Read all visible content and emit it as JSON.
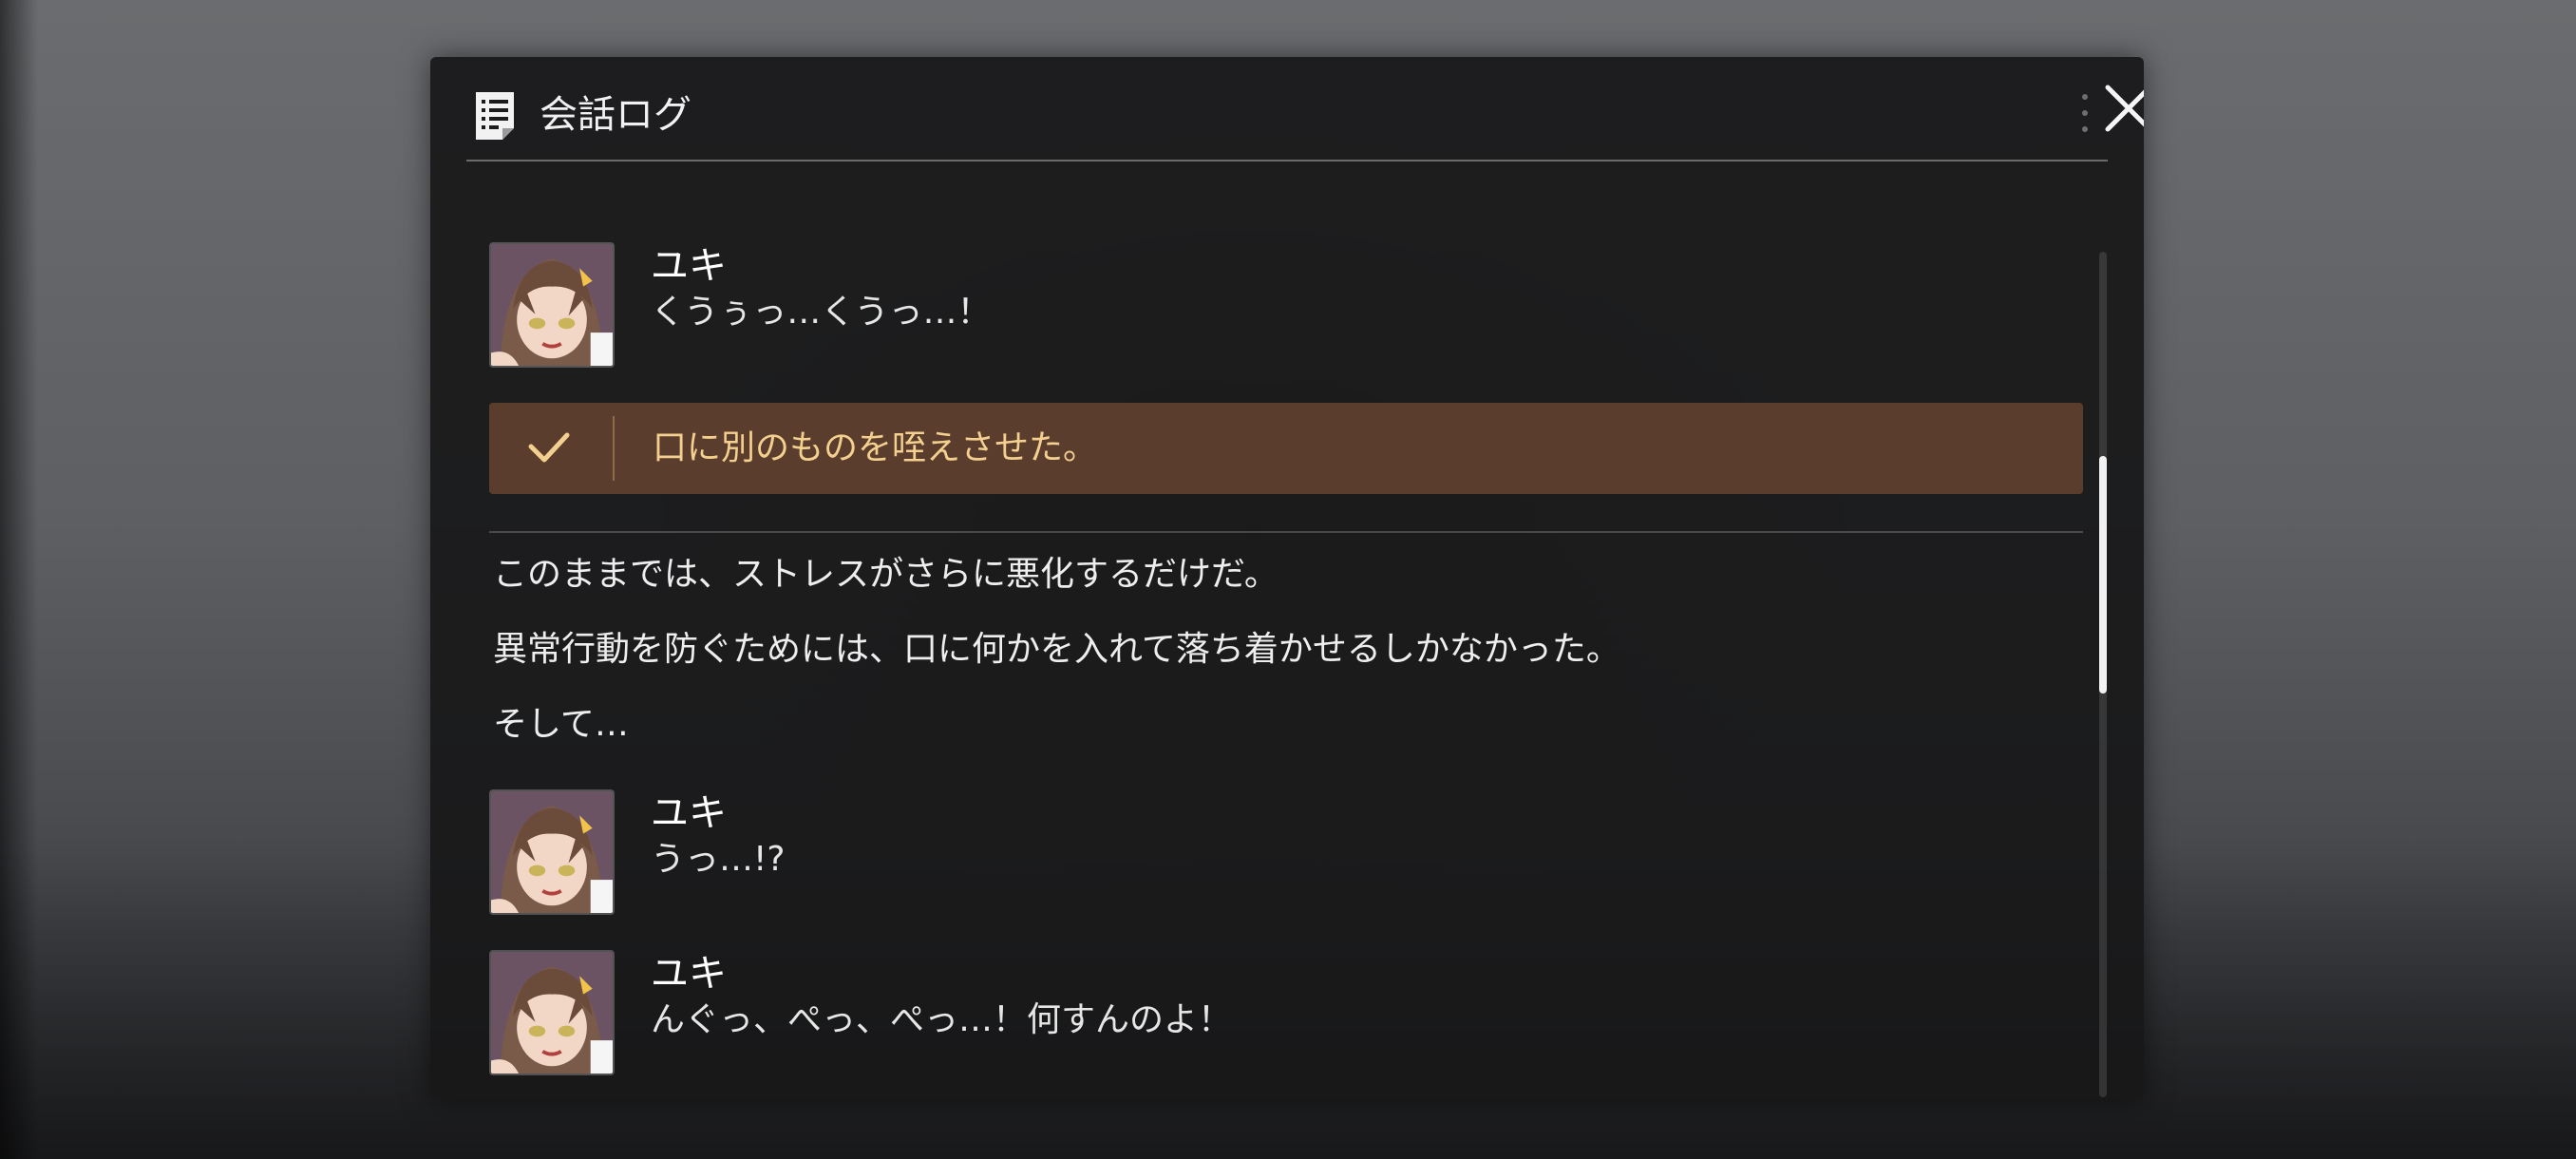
{
  "dialog": {
    "title": "会話ログ",
    "title_icon": "log-document-icon",
    "close_icon": "close-icon"
  },
  "log": {
    "entries": [
      {
        "speaker": "ユキ",
        "text": "くうぅっ…くうっ…！"
      },
      {
        "choice": "口に別のものを咥えさせた。"
      },
      {
        "narration": "このままでは、ストレスがさらに悪化するだけだ。"
      },
      {
        "narration": "異常行動を防ぐためには、口に何かを入れて落ち着かせるしかなかった。"
      },
      {
        "narration": "そして…"
      },
      {
        "speaker": "ユキ",
        "text": "うっ…!?"
      },
      {
        "speaker": "ユキ",
        "text": "んぐっ、ぺっ、ぺっ…！何すんのよ！"
      }
    ]
  },
  "scrollbar": {
    "position": 0.27,
    "visible_fraction": 0.28
  },
  "colors": {
    "choice_bg": "#5a3d2d",
    "choice_text": "#f3d08f",
    "panel_bg": "#181819"
  }
}
